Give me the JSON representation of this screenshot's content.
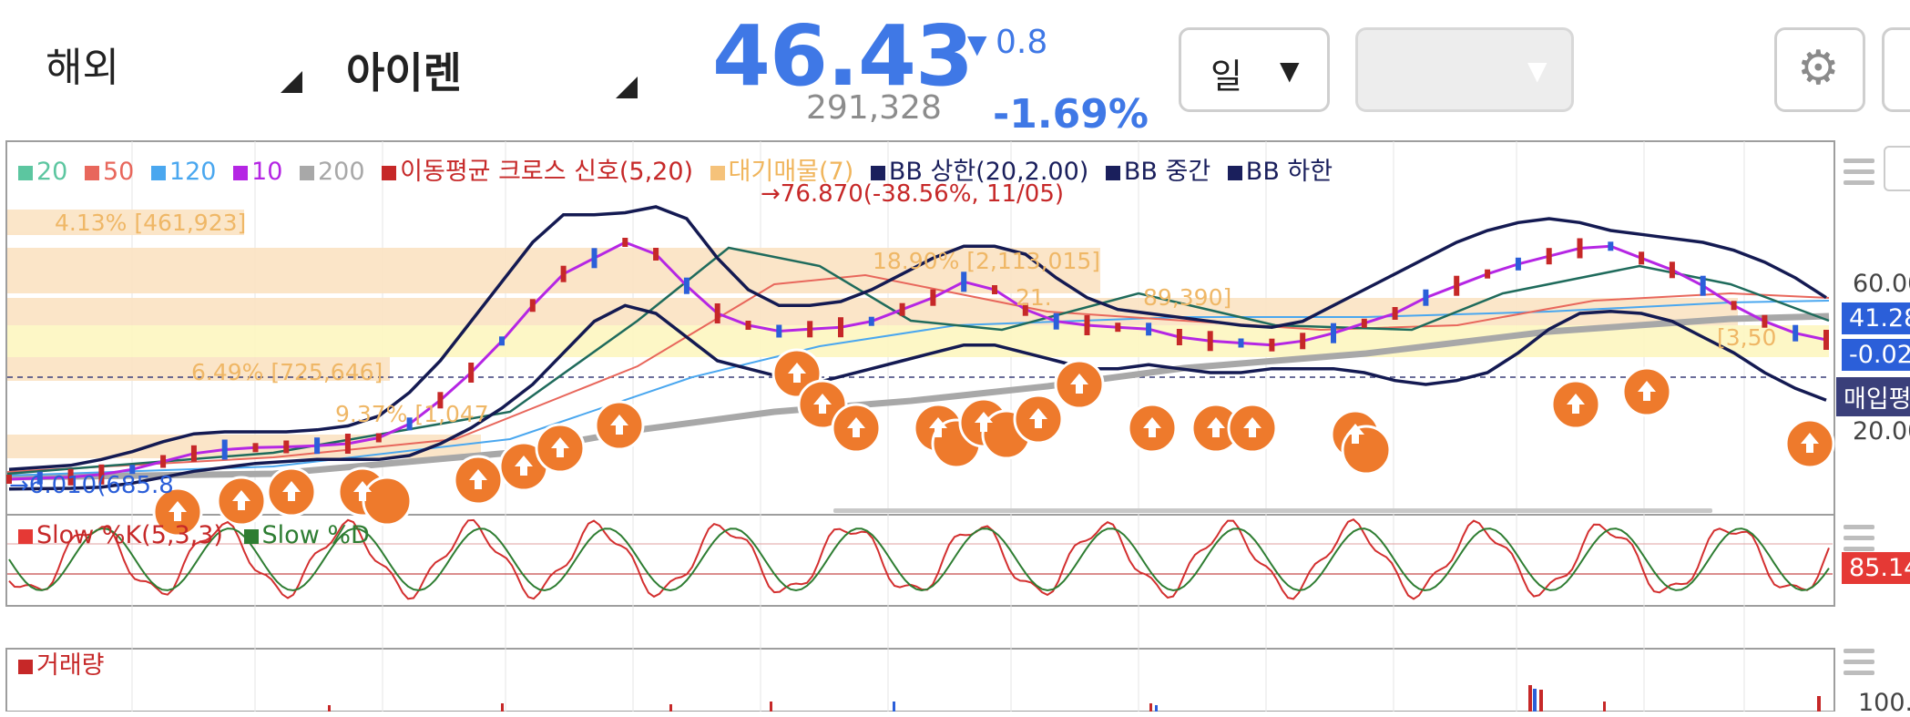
{
  "header": {
    "market": "해외",
    "stock_name": "아이렌",
    "price": "46.43",
    "volume": "291,328",
    "change_arrow": "▼",
    "change": "0.8",
    "change_pct": "-1.69%",
    "period": "일",
    "period_caret": "▼",
    "blank_caret": "▼",
    "settings_icon": "⚙",
    "colors": {
      "price": "#3f78e6"
    }
  },
  "price_panel": {
    "legend": [
      {
        "label": "20",
        "color": "#5cc6a0"
      },
      {
        "label": "50",
        "color": "#e8675c"
      },
      {
        "label": "120",
        "color": "#4aa7ef"
      },
      {
        "label": "10",
        "color": "#b526e4"
      },
      {
        "label": "200",
        "color": "#a8a8a8"
      },
      {
        "label": "이동평균 크로스 신호(5,20)",
        "color": "#c62828"
      },
      {
        "label": "대기매물(7)",
        "color": "#f5c27a"
      },
      {
        "label": "BB 상한(20,2.00)",
        "color": "#1a1f5c"
      },
      {
        "label": "BB 중간",
        "color": "#1a1f5c"
      },
      {
        "label": "BB 하한",
        "color": "#1a1f5c"
      }
    ],
    "high_label": "→76.870(-38.56%, 11/05)",
    "low_label": "→6.010(685.8",
    "supply_labels": [
      "4.13% [461,923]",
      "18.90% [2,113,015]",
      "21.",
      "89,390]",
      "6.49% [725,646]",
      "9.37% [1,047",
      "[3,50"
    ],
    "axis_labels": [
      "60.00",
      "20.00"
    ],
    "current_tag": "41.28",
    "diff_tag": "-0.02",
    "avg_tag": "매입평"
  },
  "stoch_panel": {
    "legend": [
      {
        "label": "Slow %K(5,3,3)",
        "color": "#e53935"
      },
      {
        "label": "Slow %D",
        "color": "#2e7d32"
      }
    ],
    "value_tag": "85.14"
  },
  "volume_panel": {
    "legend": [
      {
        "label": "거래량",
        "color": "#c62828"
      }
    ],
    "axis_label": "100.0"
  },
  "chart_data": {
    "type": "line",
    "x": [
      0,
      1,
      2,
      3,
      4,
      5,
      6,
      7,
      8,
      9,
      10,
      11,
      12,
      13,
      14,
      15,
      16,
      17,
      18,
      19,
      20,
      21,
      22,
      23,
      24,
      25,
      26,
      27,
      28,
      29,
      30,
      31,
      32,
      33,
      34,
      35,
      36,
      37,
      38,
      39,
      40,
      41,
      42,
      43,
      44,
      45,
      46,
      47,
      48,
      49,
      50,
      51,
      52,
      53,
      54,
      55,
      56,
      57,
      58,
      59
    ],
    "series": [
      {
        "name": "10",
        "values": [
          6.0,
          6.3,
          6.5,
          7.2,
          8.5,
          10.5,
          12.5,
          13.5,
          14.0,
          14.2,
          14.5,
          15.0,
          16.5,
          20.0,
          26.0,
          33.0,
          41.0,
          50.0,
          58.0,
          62.0,
          66.0,
          63.0,
          55.0,
          48.0,
          45.0,
          43.5,
          44.0,
          44.5,
          46.0,
          49.0,
          52.0,
          56.0,
          54.0,
          49.0,
          46.0,
          45.0,
          44.5,
          44.0,
          42.0,
          41.0,
          40.5,
          40.0,
          41.0,
          43.0,
          45.5,
          48.0,
          52.0,
          55.0,
          58.0,
          60.5,
          62.5,
          64.5,
          65.0,
          62.0,
          59.0,
          55.0,
          50.0,
          46.0,
          43.0,
          41.3
        ]
      },
      {
        "name": "BB 상한(20,2.00)",
        "values": [
          8.5,
          9.0,
          9.5,
          11.0,
          13.0,
          15.5,
          17.5,
          18.0,
          18.0,
          18.0,
          18.5,
          19.5,
          22.0,
          28.0,
          36.0,
          46.0,
          56.0,
          66.0,
          73.0,
          73.0,
          73.5,
          75.0,
          72.0,
          62.0,
          54.0,
          50.0,
          50.0,
          51.0,
          54.0,
          58.0,
          62.0,
          65.0,
          65.0,
          63.0,
          57.0,
          52.0,
          49.0,
          48.0,
          47.0,
          46.0,
          45.0,
          44.5,
          46.0,
          50.0,
          54.0,
          58.0,
          62.0,
          66.0,
          69.0,
          71.0,
          72.0,
          71.0,
          69.0,
          68.0,
          67.0,
          66.0,
          64.0,
          61.0,
          57.0,
          52.0
        ]
      },
      {
        "name": "BB 하한",
        "values": [
          3.5,
          3.6,
          3.7,
          4.0,
          5.0,
          6.5,
          8.0,
          9.0,
          10.0,
          10.5,
          11.0,
          11.0,
          11.0,
          12.0,
          15.0,
          19.0,
          24.0,
          30.0,
          38.0,
          46.0,
          50.0,
          48.0,
          42.0,
          36.0,
          34.0,
          32.0,
          30.0,
          32.0,
          34.0,
          36.0,
          38.0,
          40.0,
          40.0,
          38.0,
          36.0,
          34.0,
          34.0,
          35.0,
          34.0,
          33.0,
          33.0,
          34.0,
          34.0,
          34.0,
          33.0,
          31.0,
          30.0,
          31.0,
          33.0,
          38.0,
          44.0,
          48.0,
          48.5,
          48.0,
          46.0,
          42.0,
          38.0,
          33.0,
          29.0,
          26.0
        ]
      }
    ],
    "ylabel": "",
    "ylim": [
      0,
      90
    ]
  }
}
